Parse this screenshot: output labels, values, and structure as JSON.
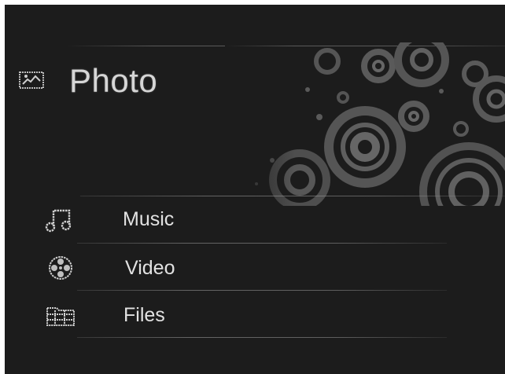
{
  "header": {
    "title": "Photo",
    "icon": "photo-icon"
  },
  "menu": {
    "items": [
      {
        "label": "Music",
        "icon": "music-note-icon"
      },
      {
        "label": "Video",
        "icon": "film-reel-icon"
      },
      {
        "label": "Files",
        "icon": "folder-icon"
      }
    ]
  },
  "colors": {
    "background": "#1c1c1c",
    "text": "#e2e2e2",
    "accent_rings": "#5a5a5a"
  }
}
